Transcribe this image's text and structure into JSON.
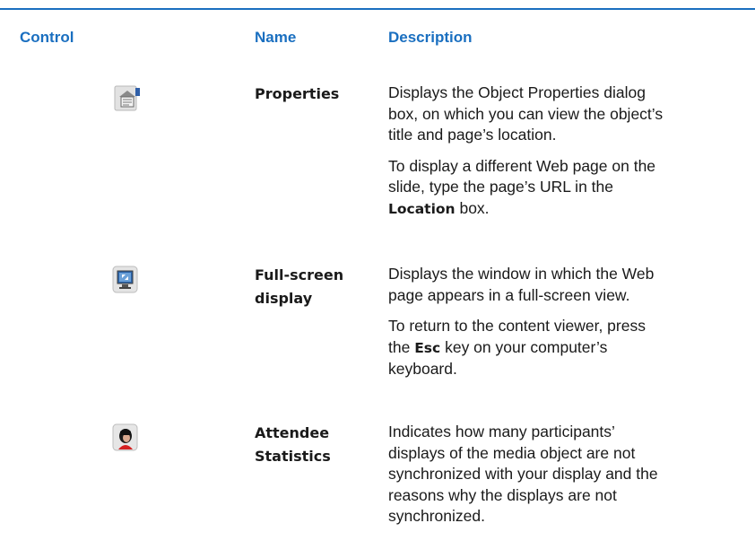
{
  "header": {
    "control": "Control",
    "name": "Name",
    "description": "Description"
  },
  "rows": [
    {
      "icon": "properties-icon",
      "name_lines": [
        "Properties"
      ],
      "paragraphs": [
        [
          "Displays the Object Properties dialog",
          "box, on which you can view the object’s",
          "title and page’s location."
        ],
        [
          "To display a different Web page on the",
          "slide, type the page’s URL in the"
        ]
      ],
      "p2_line3_keyword": "Location",
      "p2_line3_rest": " box."
    },
    {
      "icon": "full-screen-display-icon",
      "name_lines": [
        "Full-screen",
        "display"
      ],
      "paragraphs": [
        [
          "Displays the window in which the Web",
          "page appears in a full-screen view."
        ],
        [
          "To return to the content viewer, press"
        ]
      ],
      "p2_line2_pre": "the ",
      "p2_line2_keyword": "Esc",
      "p2_line2_rest": " key on your computer’s",
      "p2_line3": "keyboard."
    },
    {
      "icon": "attendee-statistics-icon",
      "name_lines": [
        "Attendee",
        "Statistics"
      ],
      "paragraphs": [
        [
          "Indicates how many participants’",
          "displays of the media object are not",
          "synchronized with your display and the",
          "reasons why the displays are not",
          "synchronized."
        ]
      ]
    }
  ]
}
